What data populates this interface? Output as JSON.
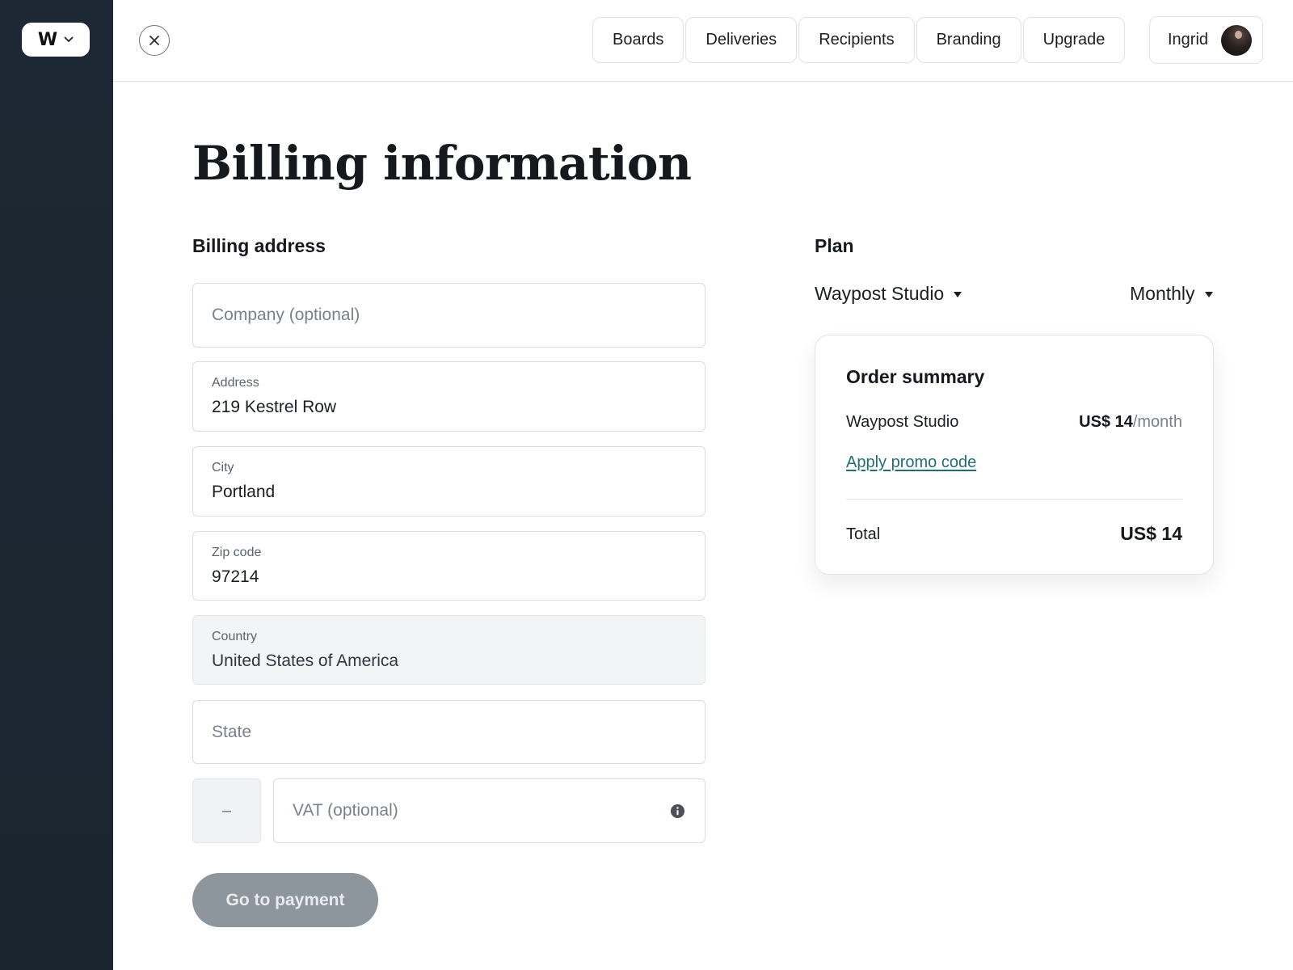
{
  "sidebar": {
    "workspace_logo": "W",
    "workspace_icon": "w-logo-icon",
    "chevron_icon": "chevron-down-icon"
  },
  "header": {
    "close_icon": "close-icon",
    "nav": [
      {
        "label": "Boards"
      },
      {
        "label": "Deliveries"
      },
      {
        "label": "Recipients"
      },
      {
        "label": "Branding"
      },
      {
        "label": "Upgrade"
      }
    ],
    "user": {
      "name": "Ingrid",
      "avatar": "avatar"
    }
  },
  "page": {
    "title": "Billing information"
  },
  "billing": {
    "heading": "Billing address",
    "company": {
      "placeholder": "Company (optional)",
      "value": ""
    },
    "address": {
      "label": "Address",
      "value": "219 Kestrel Row"
    },
    "city": {
      "label": "City",
      "value": "Portland"
    },
    "zip": {
      "label": "Zip code",
      "value": "97214"
    },
    "country": {
      "label": "Country",
      "value": "United States of America"
    },
    "state": {
      "placeholder": "State",
      "value": ""
    },
    "vat_prefix": "–",
    "vat": {
      "placeholder": "VAT (optional)",
      "value": ""
    },
    "info_icon": "info-icon",
    "submit_label": "Go to payment"
  },
  "plan": {
    "heading": "Plan",
    "selected_plan": "Waypost Studio",
    "selected_period": "Monthly",
    "summary": {
      "title": "Order summary",
      "item_name": "Waypost Studio",
      "item_price": "US$ 14",
      "item_period": "/month",
      "promo_label": "Apply promo code",
      "total_label": "Total",
      "total_value": "US$ 14"
    }
  },
  "colors": {
    "sidebar_bg": "#1c2833",
    "link": "#1f6e77",
    "button_disabled": "#8d969d"
  }
}
